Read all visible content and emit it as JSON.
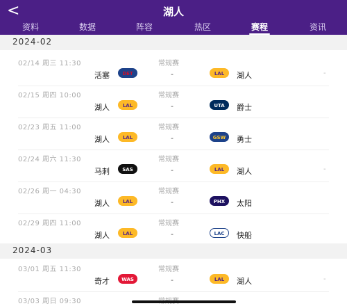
{
  "header": {
    "back_icon": "chevron-left-icon",
    "back_glyph": "<",
    "title": "湖人",
    "tabs": [
      {
        "label": "资料"
      },
      {
        "label": "数据"
      },
      {
        "label": "阵容"
      },
      {
        "label": "热区"
      },
      {
        "label": "赛程"
      },
      {
        "label": "资讯"
      }
    ],
    "active_tab": "赛程"
  },
  "schedule": {
    "months": [
      {
        "label": "2024-02",
        "games": [
          {
            "meta": "02/14 周三 11:30",
            "stage": "常规赛",
            "home": "活塞",
            "home_logo": "DET",
            "score": "-",
            "away": "湖人",
            "away_logo": "LAL",
            "side": "-"
          },
          {
            "meta": "02/15 周四 10:00",
            "stage": "常规赛",
            "home": "湖人",
            "home_logo": "LAL",
            "score": "-",
            "away": "爵士",
            "away_logo": "UTA",
            "side": ""
          },
          {
            "meta": "02/23 周五 11:00",
            "stage": "常规赛",
            "home": "湖人",
            "home_logo": "LAL",
            "score": "-",
            "away": "勇士",
            "away_logo": "GSW",
            "side": ""
          },
          {
            "meta": "02/24 周六 11:30",
            "stage": "常规赛",
            "home": "马刺",
            "home_logo": "SAS",
            "score": "-",
            "away": "湖人",
            "away_logo": "LAL",
            "side": "-"
          },
          {
            "meta": "02/26 周一 04:30",
            "stage": "常规赛",
            "home": "湖人",
            "home_logo": "LAL",
            "score": "-",
            "away": "太阳",
            "away_logo": "PHX",
            "side": ""
          },
          {
            "meta": "02/29 周四 11:00",
            "stage": "常规赛",
            "home": "湖人",
            "home_logo": "LAL",
            "score": "-",
            "away": "快船",
            "away_logo": "LAC",
            "side": ""
          }
        ]
      },
      {
        "label": "2024-03",
        "games": [
          {
            "meta": "03/01 周五 11:30",
            "stage": "常规赛",
            "home": "奇才",
            "home_logo": "WAS",
            "score": "-",
            "away": "湖人",
            "away_logo": "LAL",
            "side": "-"
          },
          {
            "meta": "03/03 周日 09:30",
            "stage": "常规赛",
            "home": "",
            "home_logo": "",
            "score": "",
            "away": "",
            "away_logo": "",
            "side": ""
          }
        ]
      }
    ]
  },
  "colors": {
    "header_bg": "#4b1f86",
    "LAL": {
      "bg": "#fdb927",
      "fg": "#552583"
    },
    "DET": {
      "bg": "#1d428a",
      "fg": "#c8102e"
    },
    "UTA": {
      "bg": "#002b5c",
      "fg": "#ffffff"
    },
    "GSW": {
      "bg": "#1d428a",
      "fg": "#ffc72c"
    },
    "SAS": {
      "bg": "#111111",
      "fg": "#ffffff"
    },
    "PHX": {
      "bg": "#1d1160",
      "fg": "#ffffff"
    },
    "LAC": {
      "bg": "#ffffff",
      "fg": "#1d428a"
    },
    "WAS": {
      "bg": "#e31837",
      "fg": "#ffffff"
    }
  }
}
